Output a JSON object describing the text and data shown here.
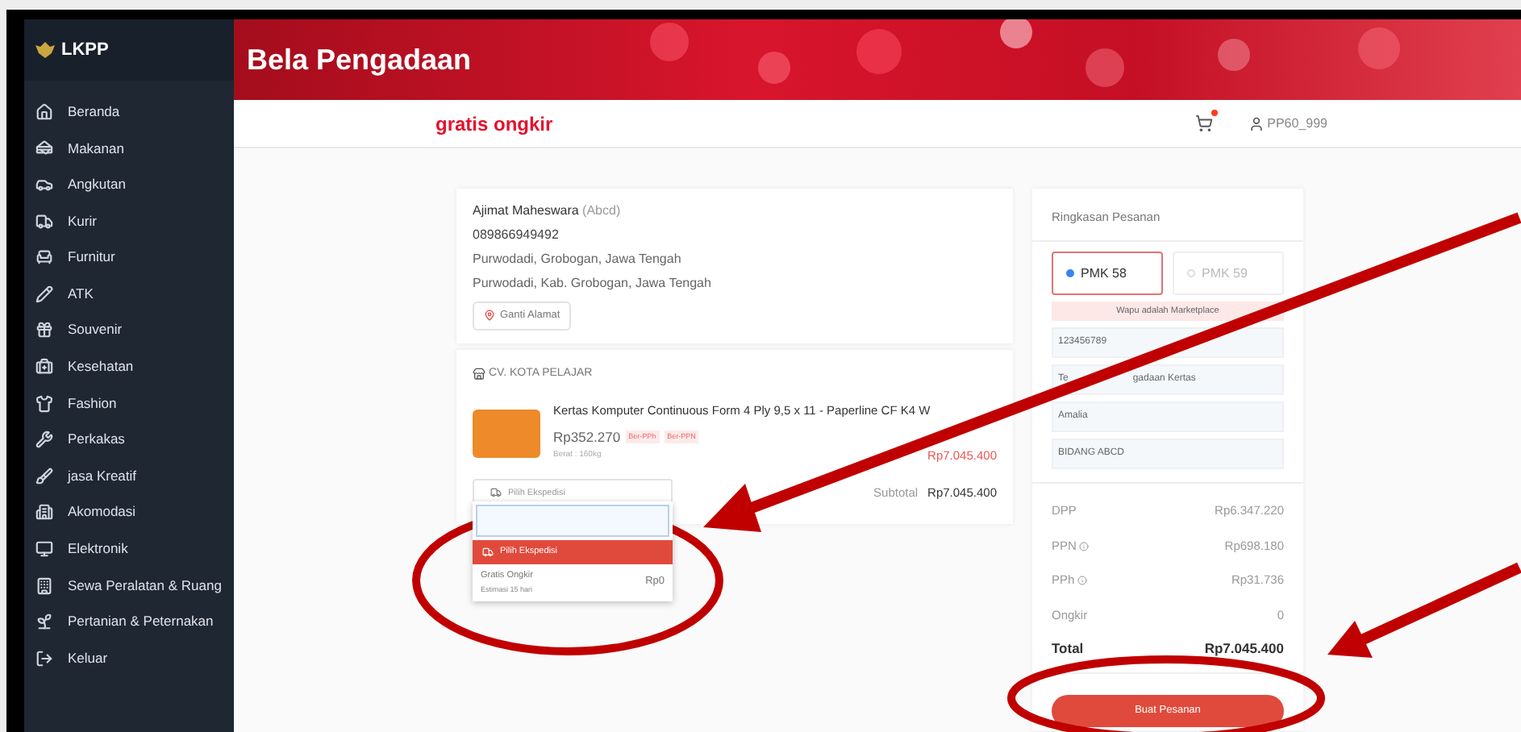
{
  "sidebar": {
    "logo_text": "LKPP",
    "items": [
      {
        "label": "Beranda"
      },
      {
        "label": "Makanan"
      },
      {
        "label": "Angkutan"
      },
      {
        "label": "Kurir"
      },
      {
        "label": "Furnitur"
      },
      {
        "label": "ATK"
      },
      {
        "label": "Souvenir"
      },
      {
        "label": "Kesehatan"
      },
      {
        "label": "Fashion"
      },
      {
        "label": "Perkakas"
      },
      {
        "label": "jasa Kreatif"
      },
      {
        "label": "Akomodasi"
      },
      {
        "label": "Elektronik"
      },
      {
        "label": "Sewa Peralatan & Ruang"
      },
      {
        "label": "Pertanian & Peternakan"
      },
      {
        "label": "Keluar"
      }
    ]
  },
  "header": {
    "title": "Bela Pengadaan"
  },
  "topbar": {
    "logo_text": "gratis ongkir",
    "cart_badge": true,
    "user": "PP60_999"
  },
  "address": {
    "name": "Ajimat Maheswara",
    "alias": "(Abcd)",
    "phone": "089866949492",
    "lines": [
      "Purwodadi, Grobogan, Jawa Tengah",
      "Purwodadi, Kab. Grobogan, Jawa Tengah"
    ],
    "change_button": "Ganti Alamat"
  },
  "store": {
    "name": "CV. KOTA PELAJAR",
    "product": {
      "title": "Kertas Komputer Continuous Form 4 Ply 9,5 x 11 - Paperline CF K4 W",
      "price": "Rp352.270",
      "tags": [
        "Ber-PPh",
        "Ber-PPN"
      ],
      "weight": "Berat : 160kg",
      "line_total": "Rp7.045.400"
    },
    "courier_button": "Pilih Ekspedisi",
    "subtotal_label": "Subtotal",
    "subtotal": "Rp7.045.400",
    "dropdown": {
      "header": "Pilih Ekspedisi",
      "options": [
        {
          "name": "Gratis Ongkir",
          "estimate": "Estimasi 15 hari",
          "price": "Rp0"
        }
      ]
    }
  },
  "summary": {
    "title": "Ringkasan Pesanan",
    "options": [
      {
        "label": "PMK 58",
        "selected": true
      },
      {
        "label": "PMK 59",
        "selected": false
      }
    ],
    "notice": "Wapu adalah Marketplace",
    "fields": [
      {
        "parts": [
          "123456789"
        ]
      },
      {
        "parts": [
          "Te",
          "gadaan Kertas"
        ]
      },
      {
        "parts": [
          "Amalia"
        ]
      },
      {
        "parts": [
          "BIDANG ABCD"
        ]
      }
    ],
    "rows": [
      {
        "label": "DPP",
        "value": "Rp6.347.220",
        "info": false
      },
      {
        "label": "PPN",
        "value": "Rp698.180",
        "info": true
      },
      {
        "label": "PPh",
        "value": "Rp31.736",
        "info": true
      },
      {
        "label": "Ongkir",
        "value": "0",
        "info": false
      }
    ],
    "total_label": "Total",
    "total": "Rp7.045.400",
    "submit": "Buat Pesanan"
  }
}
